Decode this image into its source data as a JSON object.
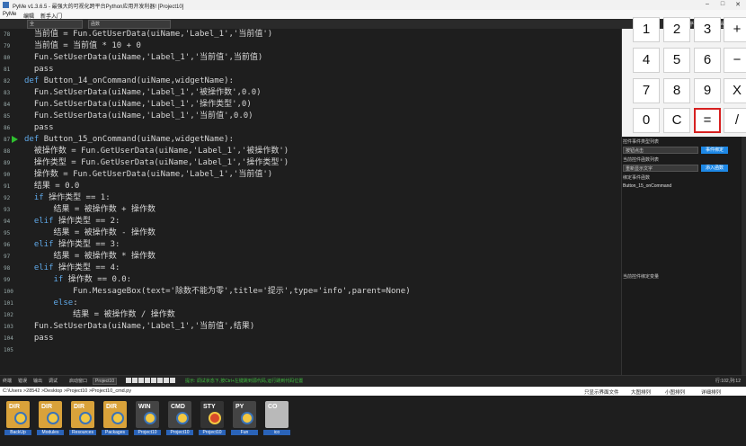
{
  "window": {
    "title": "PyMe v1.3.6.5 - 最强大的可视化跨平台Python应用开发利器! [Project10]",
    "controls": [
      "–",
      "□",
      "✕"
    ]
  },
  "menu": [
    "PyMe",
    "编辑",
    "新手入门"
  ],
  "toolbar": {
    "left_select_1": "全",
    "left_select_2": "函数",
    "right_items": [
      "加",
      "平台",
      "window",
      "运行"
    ]
  },
  "editor": {
    "lines": [
      {
        "n": "78",
        "segs": [
          [
            "  当前值 = Fun.GetUserData(uiName,'Label_1','当前值')",
            "plain"
          ]
        ]
      },
      {
        "n": "79",
        "segs": [
          [
            "  当前值 = 当前值 * 10 + 0",
            "plain"
          ]
        ]
      },
      {
        "n": "80",
        "segs": [
          [
            "  Fun.SetUserData(uiName,'Label_1','当前值',当前值)",
            "plain"
          ]
        ]
      },
      {
        "n": "81",
        "segs": [
          [
            "  pass",
            "plain"
          ]
        ]
      },
      {
        "n": "82",
        "segs": [
          [
            "def ",
            "kw"
          ],
          [
            "Button_14_onCommand(uiName,widgetName):",
            "plain"
          ]
        ]
      },
      {
        "n": "83",
        "segs": [
          [
            "  Fun.SetUserData(uiName,'Label_1','被操作数',0.0)",
            "plain"
          ]
        ]
      },
      {
        "n": "84",
        "segs": [
          [
            "  Fun.SetUserData(uiName,'Label_1','操作类型',0)",
            "plain"
          ]
        ]
      },
      {
        "n": "85",
        "segs": [
          [
            "  Fun.SetUserData(uiName,'Label_1','当前值',0.0)",
            "plain"
          ]
        ]
      },
      {
        "n": "86",
        "segs": [
          [
            "  pass",
            "plain"
          ]
        ]
      },
      {
        "n": "87",
        "segs": [
          [
            "def ",
            "kw"
          ],
          [
            "Button_15_onCommand(uiName,widgetName):",
            "plain"
          ]
        ]
      },
      {
        "n": "88",
        "segs": [
          [
            "  被操作数 = Fun.GetUserData(uiName,'Label_1','被操作数')",
            "plain"
          ]
        ]
      },
      {
        "n": "89",
        "segs": [
          [
            "  操作类型 = Fun.GetUserData(uiName,'Label_1','操作类型')",
            "plain"
          ]
        ]
      },
      {
        "n": "90",
        "segs": [
          [
            "  操作数 = Fun.GetUserData(uiName,'Label_1','当前值')",
            "plain"
          ]
        ]
      },
      {
        "n": "91",
        "segs": [
          [
            "  结果 = 0.0",
            "plain"
          ]
        ]
      },
      {
        "n": "92",
        "segs": [
          [
            "  ",
            "plain"
          ],
          [
            "if ",
            "kw"
          ],
          [
            "操作类型 == 1:",
            "plain"
          ]
        ]
      },
      {
        "n": "93",
        "segs": [
          [
            "      结果 = 被操作数 + 操作数",
            "plain"
          ]
        ]
      },
      {
        "n": "94",
        "segs": [
          [
            "  ",
            "plain"
          ],
          [
            "elif ",
            "kw"
          ],
          [
            "操作类型 == 2:",
            "plain"
          ]
        ]
      },
      {
        "n": "95",
        "segs": [
          [
            "      结果 = 被操作数 - 操作数",
            "plain"
          ]
        ]
      },
      {
        "n": "96",
        "segs": [
          [
            "  ",
            "plain"
          ],
          [
            "elif ",
            "kw"
          ],
          [
            "操作类型 == 3:",
            "plain"
          ]
        ]
      },
      {
        "n": "97",
        "segs": [
          [
            "      结果 = 被操作数 * 操作数",
            "plain"
          ]
        ]
      },
      {
        "n": "98",
        "segs": [
          [
            "  ",
            "plain"
          ],
          [
            "elif ",
            "kw"
          ],
          [
            "操作类型 == 4:",
            "plain"
          ]
        ]
      },
      {
        "n": "99",
        "segs": [
          [
            "      ",
            "plain"
          ],
          [
            "if ",
            "kw"
          ],
          [
            "操作数 == 0.0:",
            "plain"
          ]
        ]
      },
      {
        "n": "100",
        "segs": [
          [
            "          Fun.MessageBox(text='除数不能为零',title='提示',type='info',parent=None)",
            "plain"
          ]
        ]
      },
      {
        "n": "101",
        "segs": [
          [
            "      ",
            "plain"
          ],
          [
            "else",
            "kw"
          ],
          [
            ":",
            "plain"
          ]
        ]
      },
      {
        "n": "102",
        "segs": [
          [
            "          结果 = 被操作数 / 操作数",
            "plain"
          ]
        ]
      },
      {
        "n": "103",
        "segs": [
          [
            "  Fun.SetUserData(uiName,'Label_1','当前值',结果)",
            "plain"
          ]
        ]
      },
      {
        "n": "104",
        "segs": [
          [
            "  pass",
            "plain"
          ]
        ]
      },
      {
        "n": "105",
        "segs": [
          [
            "",
            "plain"
          ]
        ]
      }
    ],
    "run_marker_line": "87"
  },
  "calculator": {
    "rows": [
      [
        "1",
        "2",
        "3",
        "+"
      ],
      [
        "4",
        "5",
        "6",
        "−"
      ],
      [
        "7",
        "8",
        "9",
        "X"
      ],
      [
        "0",
        "C",
        "=",
        "/"
      ]
    ],
    "selected": "="
  },
  "events_panel": {
    "type_list_label": "控件事件类型列表",
    "type_select": "按钮点击",
    "bind_button": "事件绑定",
    "func_list_label": "当前控件函数列表",
    "func_select": "重新显示文字",
    "add_button": "添入函数",
    "bound_label": "绑定事件函数",
    "bound_item": "Button_15_onCommand",
    "var_label": "当前控件绑定变量"
  },
  "statusbar": {
    "tabs": [
      "终端",
      "错误",
      "输出",
      "调试"
    ],
    "target_label": "启动窗口",
    "target_select": "Project10",
    "hint": "提示: 调试状态下,按Ctrl+左键跳到源代码,运行跳到代码位置",
    "position": "行:102,列:12"
  },
  "breadcrumb": {
    "path": "C:\\Users >28542 >Desktop >Project10 >Project10_cmd.py",
    "right_items": [
      "只显示界面文件",
      "大图排列",
      "小图排列",
      "详细排列"
    ]
  },
  "files": [
    {
      "tag": "DIR",
      "caption": "BackUp",
      "kind": "dir"
    },
    {
      "tag": "DIR",
      "caption": "Modules",
      "kind": "dir"
    },
    {
      "tag": "DIR",
      "caption": "Resources",
      "kind": "dir"
    },
    {
      "tag": "DIR",
      "caption": "Packages",
      "kind": "dir"
    },
    {
      "tag": "WIN",
      "caption": "Project10",
      "kind": "py"
    },
    {
      "tag": "CMD",
      "caption": "Project10",
      "kind": "py"
    },
    {
      "tag": "STY",
      "caption": "Project10",
      "kind": "sty"
    },
    {
      "tag": "PY",
      "caption": "Fun",
      "kind": "py"
    },
    {
      "tag": "CO",
      "caption": "ico",
      "kind": "ico"
    }
  ]
}
